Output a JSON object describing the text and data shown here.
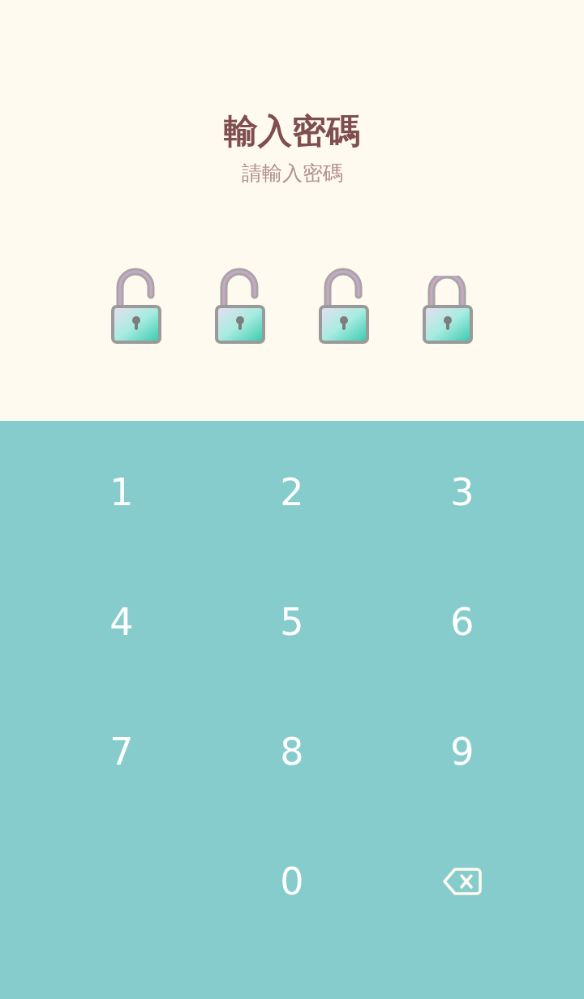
{
  "header": {
    "title": "輸入密碼",
    "subtitle": "請輸入密碼"
  },
  "indicators": [
    {
      "locked": false
    },
    {
      "locked": false
    },
    {
      "locked": false
    },
    {
      "locked": true
    }
  ],
  "keypad": [
    {
      "kind": "digit",
      "label": "1"
    },
    {
      "kind": "digit",
      "label": "2"
    },
    {
      "kind": "digit",
      "label": "3"
    },
    {
      "kind": "digit",
      "label": "4"
    },
    {
      "kind": "digit",
      "label": "5"
    },
    {
      "kind": "digit",
      "label": "6"
    },
    {
      "kind": "digit",
      "label": "7"
    },
    {
      "kind": "digit",
      "label": "8"
    },
    {
      "kind": "digit",
      "label": "9"
    },
    {
      "kind": "blank"
    },
    {
      "kind": "digit",
      "label": "0"
    },
    {
      "kind": "backspace"
    }
  ]
}
